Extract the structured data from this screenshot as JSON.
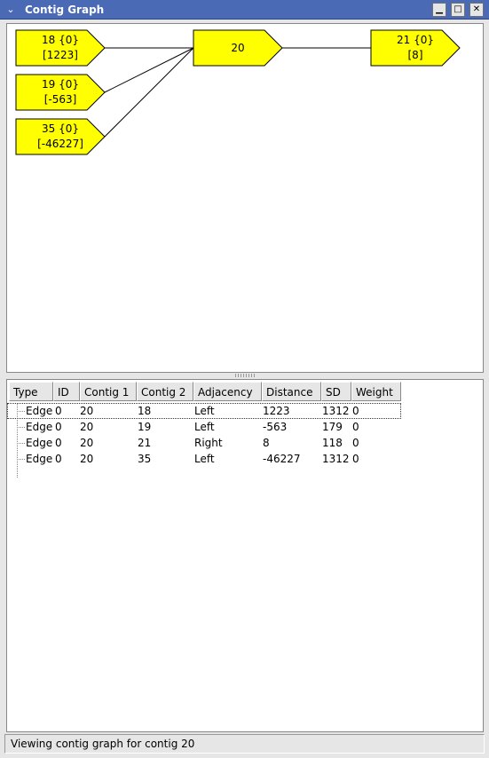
{
  "window": {
    "title": "Contig Graph",
    "menu_icon": "chevron-down-icon",
    "buttons": {
      "minimize": "▁",
      "maximize": "□",
      "close": "✕"
    }
  },
  "graph": {
    "node_fill": "#ffff00",
    "nodes": [
      {
        "id": "18",
        "line1": "18 {0}",
        "line2": "[1223]"
      },
      {
        "id": "19",
        "line1": "19 {0}",
        "line2": "[-563]"
      },
      {
        "id": "35",
        "line1": "35 {0}",
        "line2": "[-46227]"
      },
      {
        "id": "20",
        "line1": "20",
        "line2": ""
      },
      {
        "id": "21",
        "line1": "21 {0}",
        "line2": "[8]"
      }
    ]
  },
  "table": {
    "columns": [
      "Type",
      "ID",
      "Contig 1",
      "Contig 2",
      "Adjacency",
      "Distance",
      "SD",
      "Weight"
    ],
    "rows": [
      [
        "Edge",
        "0",
        "20",
        "18",
        "Left",
        "1223",
        "1312",
        "0"
      ],
      [
        "Edge",
        "0",
        "20",
        "19",
        "Left",
        "-563",
        "179",
        "0"
      ],
      [
        "Edge",
        "0",
        "20",
        "21",
        "Right",
        "8",
        "118",
        "0"
      ],
      [
        "Edge",
        "0",
        "20",
        "35",
        "Left",
        "-46227",
        "1312",
        "0"
      ]
    ]
  },
  "status": {
    "text": "Viewing contig graph for contig 20"
  }
}
